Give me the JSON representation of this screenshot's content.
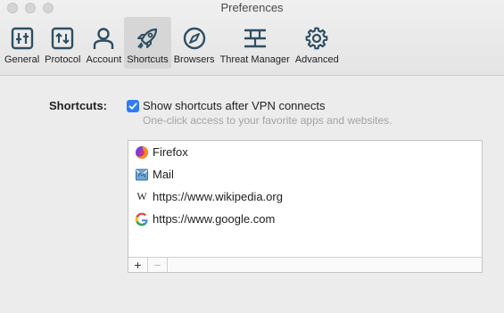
{
  "window": {
    "title": "Preferences"
  },
  "tabs": [
    {
      "label": "General",
      "icon": "sliders-icon"
    },
    {
      "label": "Protocol",
      "icon": "protocol-arrows-icon"
    },
    {
      "label": "Account",
      "icon": "person-icon"
    },
    {
      "label": "Shortcuts",
      "icon": "rocket-icon",
      "active": true
    },
    {
      "label": "Browsers",
      "icon": "compass-icon"
    },
    {
      "label": "Threat Manager",
      "icon": "threat-manager-icon"
    },
    {
      "label": "Advanced",
      "icon": "gear-icon"
    }
  ],
  "shortcuts": {
    "label": "Shortcuts:",
    "checkbox_label": "Show shortcuts after VPN connects",
    "checkbox_checked": true,
    "description": "One-click access to your favorite apps and websites.",
    "items": [
      {
        "label": "Firefox",
        "icon": "firefox-icon"
      },
      {
        "label": "Mail",
        "icon": "mail-icon"
      },
      {
        "label": "https://www.wikipedia.org",
        "icon": "wikipedia-icon"
      },
      {
        "label": "https://www.google.com",
        "icon": "google-icon"
      }
    ],
    "add_label": "+",
    "remove_label": "−"
  },
  "colors": {
    "accent": "#2f7cf6",
    "icon": "#2f4f63"
  }
}
